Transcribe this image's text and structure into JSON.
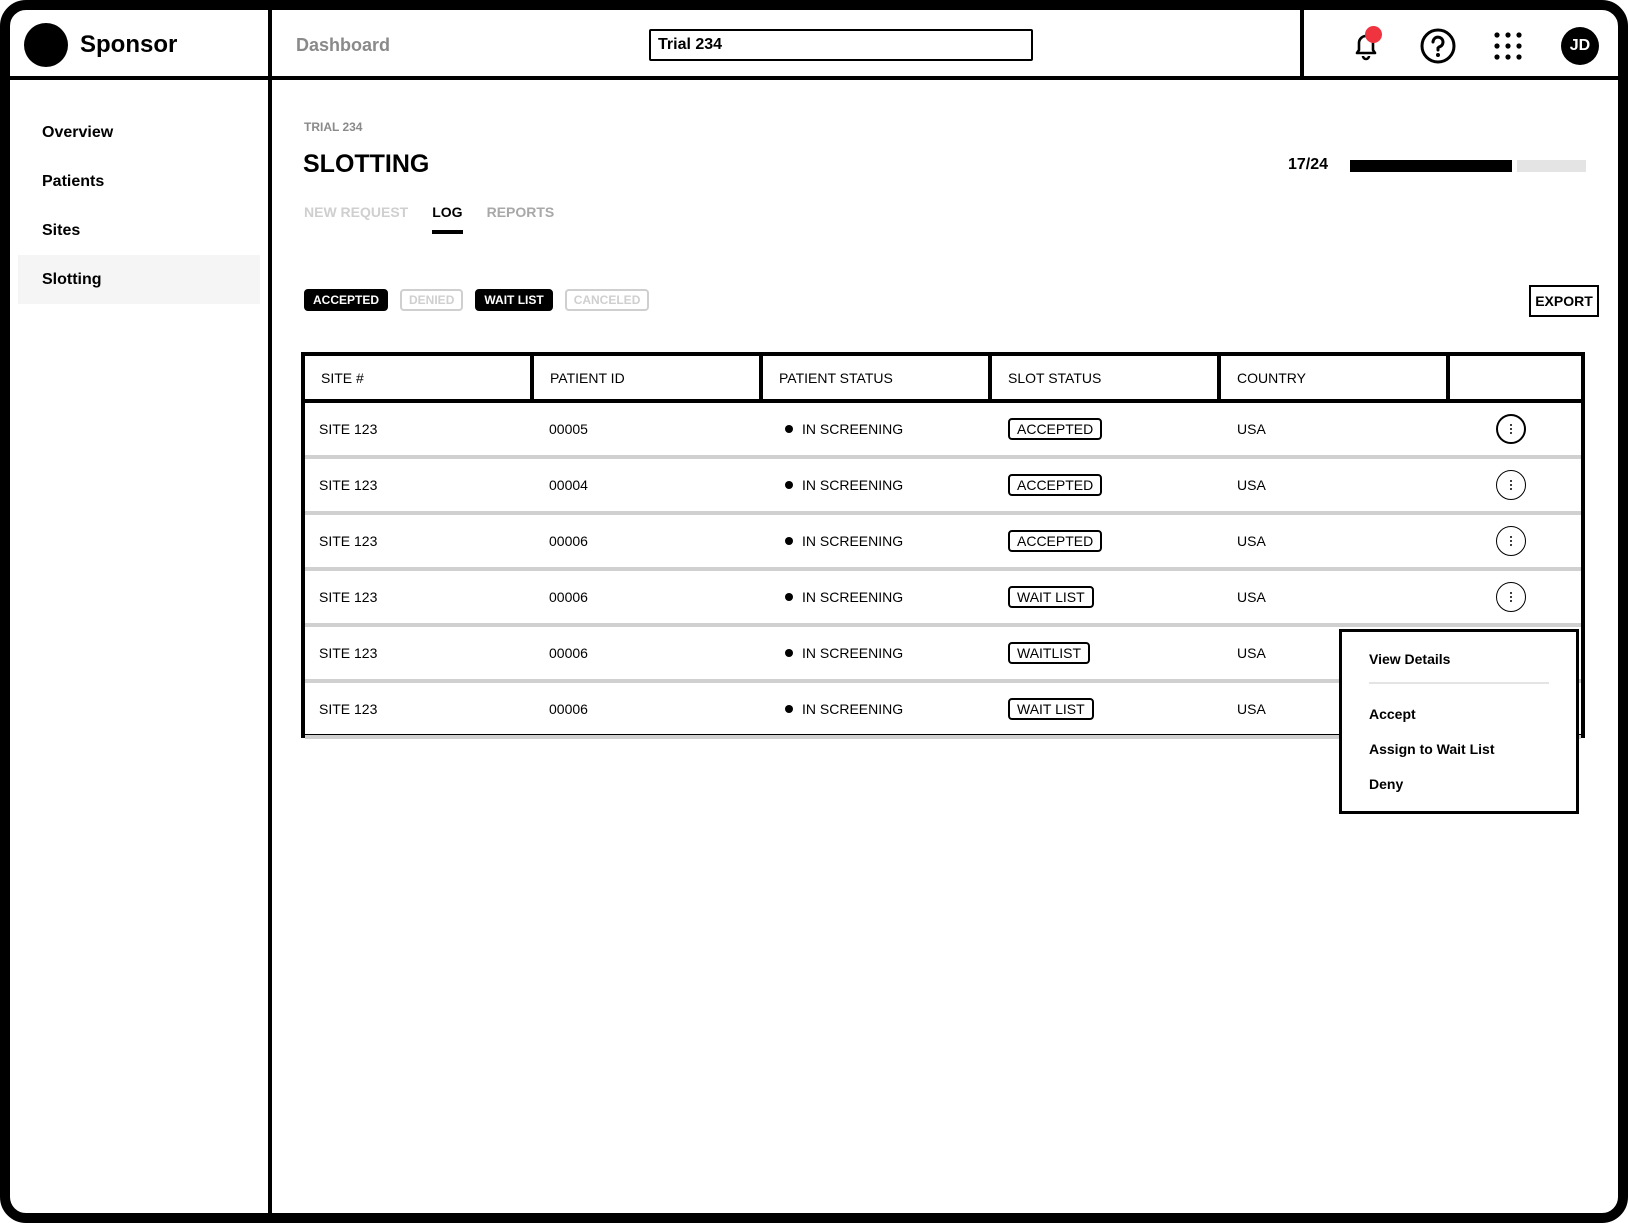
{
  "app": {
    "brand": "Sponsor",
    "breadcrumb": "Dashboard",
    "trial_selector_value": "Trial 234",
    "icons": [
      "bell-icon",
      "help-icon",
      "apps-grid-icon"
    ],
    "notification_dot_color": "#f0343f",
    "avatar_initials": "JD"
  },
  "sidebar": {
    "items": [
      {
        "label": "Overview",
        "active": false
      },
      {
        "label": "Patients",
        "active": false
      },
      {
        "label": "Sites",
        "active": false
      },
      {
        "label": "Slotting",
        "active": true
      }
    ]
  },
  "page": {
    "eyebrow": "TRIAL 234",
    "title": "SLOTTING",
    "progress": {
      "label": "17/24",
      "value": 17,
      "total": 24
    },
    "tabs": [
      {
        "label": "NEW REQUEST",
        "active": false
      },
      {
        "label": "LOG",
        "active": true
      },
      {
        "label": "REPORTS",
        "active": false
      }
    ],
    "filters": [
      {
        "label": "ACCEPTED",
        "selected": true
      },
      {
        "label": "DENIED",
        "selected": false
      },
      {
        "label": "WAIT LIST",
        "selected": true
      },
      {
        "label": "CANCELED",
        "selected": false
      }
    ],
    "export_label": "EXPORT"
  },
  "table": {
    "columns": [
      "SITE #",
      "PATIENT ID",
      "PATIENT STATUS",
      "SLOT STATUS",
      "COUNTRY",
      ""
    ],
    "rows": [
      {
        "site": "SITE 123",
        "patient_id": "00005",
        "patient_status": "IN SCREENING",
        "slot_status": "ACCEPTED",
        "country": "USA"
      },
      {
        "site": "SITE 123",
        "patient_id": "00004",
        "patient_status": "IN SCREENING",
        "slot_status": "ACCEPTED",
        "country": "USA"
      },
      {
        "site": "SITE 123",
        "patient_id": "00006",
        "patient_status": "IN SCREENING",
        "slot_status": "ACCEPTED",
        "country": "USA"
      },
      {
        "site": "SITE 123",
        "patient_id": "00006",
        "patient_status": "IN SCREENING",
        "slot_status": "WAIT LIST",
        "country": "USA"
      },
      {
        "site": "SITE 123",
        "patient_id": "00006",
        "patient_status": "IN SCREENING",
        "slot_status": "WAITLIST",
        "country": "USA"
      },
      {
        "site": "SITE 123",
        "patient_id": "00006",
        "patient_status": "IN SCREENING",
        "slot_status": "WAIT LIST",
        "country": "USA"
      }
    ]
  },
  "context_menu": {
    "items": [
      "View Details",
      "Accept",
      "Assign to Wait List",
      "Deny"
    ]
  }
}
